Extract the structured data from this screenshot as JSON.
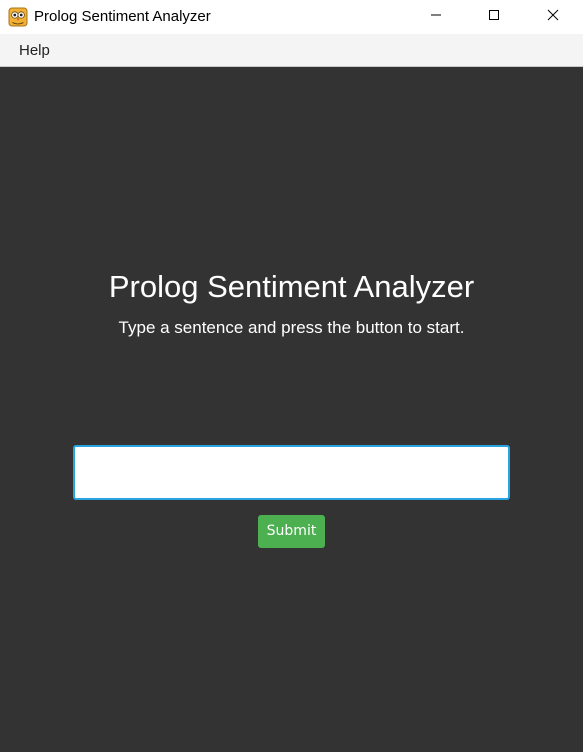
{
  "window": {
    "title": "Prolog Sentiment Analyzer",
    "app_icon": "prolog-owl-icon",
    "controls": {
      "minimize_icon": "minimize-icon",
      "maximize_icon": "maximize-icon",
      "close_icon": "close-icon"
    }
  },
  "menubar": {
    "items": [
      {
        "label": "Help"
      }
    ]
  },
  "main": {
    "heading": "Prolog Sentiment Analyzer",
    "subtitle": "Type a sentence and press the button to start.",
    "input": {
      "value": "",
      "placeholder": ""
    },
    "submit_label": "Submit"
  },
  "colors": {
    "background": "#333333",
    "titlebar": "#ffffff",
    "menubar": "#f4f4f4",
    "input_border_focus": "#29a3e0",
    "submit_button": "#4caf50",
    "text_on_dark": "#ffffff"
  }
}
